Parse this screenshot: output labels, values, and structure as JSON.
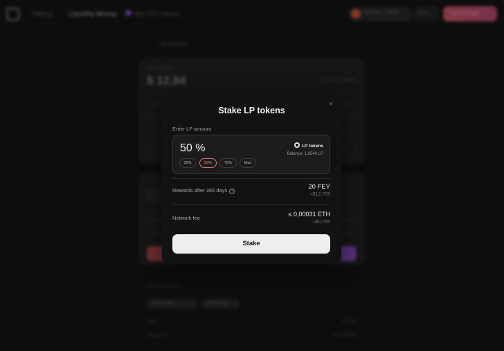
{
  "background": {
    "nav": [
      "Staking",
      "Liquidity Mining",
      "Buy FEY tokens"
    ],
    "wallet": "0xf9E6a...C8d9a",
    "chain": "ETH",
    "cta": "Launch Dapp",
    "back_arrow": "←",
    "page_title": "My position",
    "position_label": "My position",
    "position_value": "$ 12,84",
    "position_tokens": "1.6540 LP tokens",
    "summary_label": "Pool summary",
    "pool_pair": "ETH / FEY",
    "pool_tag": "0.5% fees",
    "apr_label": "APR",
    "apr_value": "102 %",
    "swap_fee_label": "Swap fee",
    "swap_fee_value": "$ 0.85780"
  },
  "modal": {
    "title": "Stake LP tokens",
    "close_icon": "×",
    "enter_label": "Enter LP amount",
    "amount_value": "50 %",
    "percent_options": [
      "25%",
      "50%",
      "75%",
      "Max"
    ],
    "selected_option": "50%",
    "token_label": "LP tokens",
    "balance": "Balance: 1,6540 LP",
    "rewards_label": "Rewards after 365 days",
    "rewards_value": "20 FEY",
    "rewards_usd": "≈$12,765",
    "fee_label": "Network fee",
    "fee_value": "≤ 0,00031 ETH",
    "fee_usd": "≈$0,765",
    "stake_button": "Stake"
  },
  "colors": {
    "accent_pink": "#e7888f",
    "modal_bg": "#121212",
    "button_bg": "#eeeeee"
  }
}
